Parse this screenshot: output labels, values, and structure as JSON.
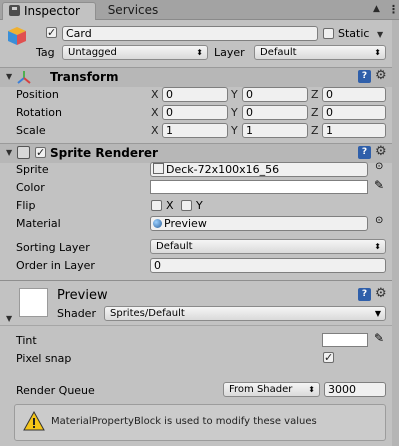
{
  "tabs": [
    {
      "label": "Inspector",
      "icon": "inspector-icon",
      "active": true
    },
    {
      "label": "Services",
      "active": false
    }
  ],
  "window_controls": {
    "menu": "⋮",
    "lock": "▲"
  },
  "gameobject": {
    "name": "Card",
    "active": true,
    "static_label": "Static",
    "static_checked": false,
    "tag_label": "Tag",
    "tag_value": "Untagged",
    "layer_label": "Layer",
    "layer_value": "Default"
  },
  "transform": {
    "title": "Transform",
    "rows": [
      {
        "label": "Position",
        "x": "0",
        "y": "0",
        "z": "0"
      },
      {
        "label": "Rotation",
        "x": "0",
        "y": "0",
        "z": "0"
      },
      {
        "label": "Scale",
        "x": "1",
        "y": "1",
        "z": "1"
      }
    ],
    "axes": [
      "X",
      "Y",
      "Z"
    ]
  },
  "sprite_renderer": {
    "title": "Sprite Renderer",
    "enabled": true,
    "sprite_label": "Sprite",
    "sprite_value": "Deck-72x100x16_56",
    "color_label": "Color",
    "flip_label": "Flip",
    "flip_x": "X",
    "flip_y": "Y",
    "material_label": "Material",
    "material_value": "Preview",
    "sorting_layer_label": "Sorting Layer",
    "sorting_layer_value": "Default",
    "order_label": "Order in Layer",
    "order_value": "0"
  },
  "material": {
    "name": "Preview",
    "shader_label": "Shader",
    "shader_value": "Sprites/Default",
    "tint_label": "Tint",
    "pixel_snap_label": "Pixel snap",
    "pixel_snap_checked": true,
    "render_queue_label": "Render Queue",
    "render_queue_mode": "From Shader",
    "render_queue_value": "3000"
  },
  "warning": {
    "text": "MaterialPropertyBlock is used to modify these values"
  },
  "colors": {
    "background": "#c2c2c2",
    "header": "#b7b7b7",
    "field": "#f0f0f0",
    "warning": "#f5c518"
  }
}
